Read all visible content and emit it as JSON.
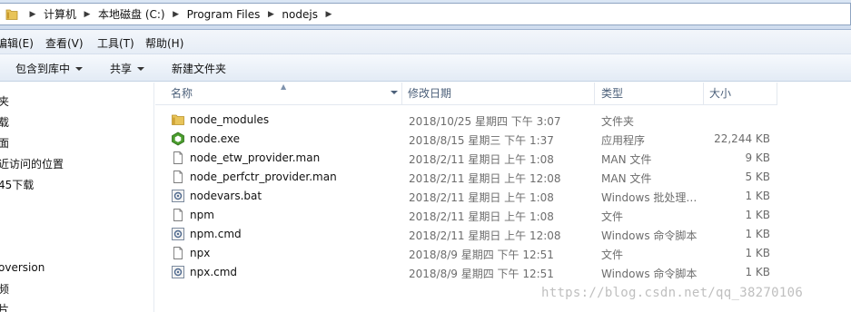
{
  "address": {
    "breadcrumbs": [
      "计算机",
      "本地磁盘 (C:)",
      "Program Files",
      "nodejs"
    ]
  },
  "menu": {
    "items": [
      "编辑(E)",
      "查看(V)",
      "工具(T)",
      "帮助(H)"
    ]
  },
  "toolbar": {
    "include_library": "包含到库中",
    "share": "共享",
    "new_folder": "新建文件夹"
  },
  "nav": {
    "items": [
      "夹",
      "载",
      "面",
      "近访问的位置",
      "45下载",
      "oversion",
      "频",
      "片"
    ]
  },
  "columns": {
    "name": "名称",
    "date": "修改日期",
    "type": "类型",
    "size": "大小"
  },
  "files": [
    {
      "name": "node_modules",
      "date": "2018/10/25 星期四 下午 3:07",
      "type": "文件夹",
      "size": "",
      "icon": "folder-icon"
    },
    {
      "name": "node.exe",
      "date": "2018/8/15 星期三 下午 1:37",
      "type": "应用程序",
      "size": "22,244 KB",
      "icon": "node-exe-icon"
    },
    {
      "name": "node_etw_provider.man",
      "date": "2018/2/11 星期日 上午 1:08",
      "type": "MAN 文件",
      "size": "9 KB",
      "icon": "document-icon"
    },
    {
      "name": "node_perfctr_provider.man",
      "date": "2018/2/11 星期日 上午 12:08",
      "type": "MAN 文件",
      "size": "5 KB",
      "icon": "document-icon"
    },
    {
      "name": "nodevars.bat",
      "date": "2018/2/11 星期日 上午 1:08",
      "type": "Windows 批处理…",
      "size": "1 KB",
      "icon": "batch-file-icon"
    },
    {
      "name": "npm",
      "date": "2018/2/11 星期日 上午 1:08",
      "type": "文件",
      "size": "1 KB",
      "icon": "document-icon"
    },
    {
      "name": "npm.cmd",
      "date": "2018/2/11 星期日 上午 12:08",
      "type": "Windows 命令脚本",
      "size": "1 KB",
      "icon": "batch-file-icon"
    },
    {
      "name": "npx",
      "date": "2018/8/9 星期四 下午 12:51",
      "type": "文件",
      "size": "1 KB",
      "icon": "document-icon"
    },
    {
      "name": "npx.cmd",
      "date": "2018/8/9 星期四 下午 12:51",
      "type": "Windows 命令脚本",
      "size": "1 KB",
      "icon": "batch-file-icon"
    }
  ],
  "watermark": "https://blog.csdn.net/qq_38270106",
  "colors": {
    "chrome_bg": "#dbe6f4",
    "header_text": "#4c607a",
    "secondary_text": "#6d6d6d",
    "folder": "#e8c45a",
    "node_green": "#4a9c2d"
  }
}
